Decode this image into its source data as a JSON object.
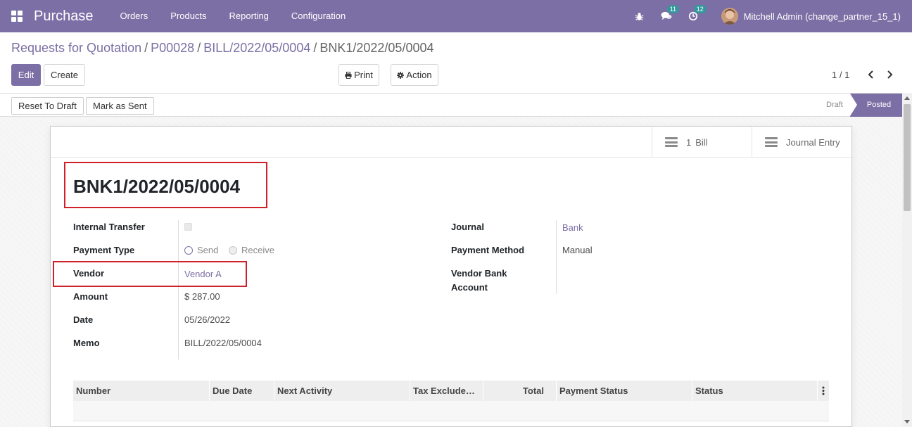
{
  "navbar": {
    "app_name": "Purchase",
    "menu": [
      "Orders",
      "Products",
      "Reporting",
      "Configuration"
    ],
    "messages_count": "11",
    "activities_count": "12",
    "user_name": "Mitchell Admin (change_partner_15_1)"
  },
  "breadcrumb": {
    "items": [
      "Requests for Quotation",
      "P00028",
      "BILL/2022/05/0004"
    ],
    "current": "BNK1/2022/05/0004"
  },
  "control": {
    "edit": "Edit",
    "create": "Create",
    "print": "Print",
    "action": "Action",
    "pager": "1 / 1"
  },
  "statusbar": {
    "reset_to_draft": "Reset To Draft",
    "mark_as_sent": "Mark as Sent",
    "stages": [
      "Draft",
      "Posted"
    ],
    "active_stage": "Posted"
  },
  "smart_buttons": {
    "bill_count": "1",
    "bill_label": "Bill",
    "journal_entry": "Journal Entry"
  },
  "record": {
    "name": "BNK1/2022/05/0004"
  },
  "fields_left": {
    "internal_transfer_label": "Internal Transfer",
    "payment_type_label": "Payment Type",
    "payment_type_send": "Send",
    "payment_type_receive": "Receive",
    "vendor_label": "Vendor",
    "vendor_value": "Vendor A",
    "amount_label": "Amount",
    "amount_value": "$ 287.00",
    "date_label": "Date",
    "date_value": "05/26/2022",
    "memo_label": "Memo",
    "memo_value": "BILL/2022/05/0004"
  },
  "fields_right": {
    "journal_label": "Journal",
    "journal_value": "Bank",
    "payment_method_label": "Payment Method",
    "payment_method_value": "Manual",
    "vendor_bank_label_1": "Vendor Bank",
    "vendor_bank_label_2": "Account"
  },
  "table": {
    "columns": [
      "Number",
      "Due Date",
      "Next Activity",
      "Tax Exclude…",
      "Total",
      "Payment Status",
      "Status"
    ]
  },
  "colors": {
    "brand": "#7c6fa5",
    "highlight": "#d0202a"
  }
}
